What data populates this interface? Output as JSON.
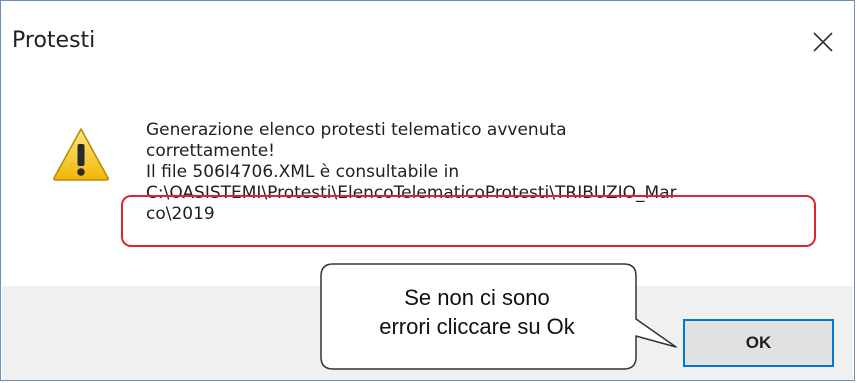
{
  "window": {
    "title": "Protesti",
    "close_icon": "close-icon"
  },
  "message": {
    "icon": "warning-icon",
    "lines": [
      "Generazione elenco protesti telematico avvenuta",
      "correttamente!",
      "Il file 506I4706.XML è consultabile in",
      "C:\\OASISTEMI\\Protesti\\ElencoTelematicoProtesti\\TRIBUZIO_Mar",
      "co\\2019"
    ]
  },
  "buttons": {
    "ok_label": "OK"
  },
  "annotation": {
    "callout_lines": [
      "Se non ci sono",
      "errori cliccare su Ok"
    ],
    "highlight_color": "#e0242f"
  }
}
